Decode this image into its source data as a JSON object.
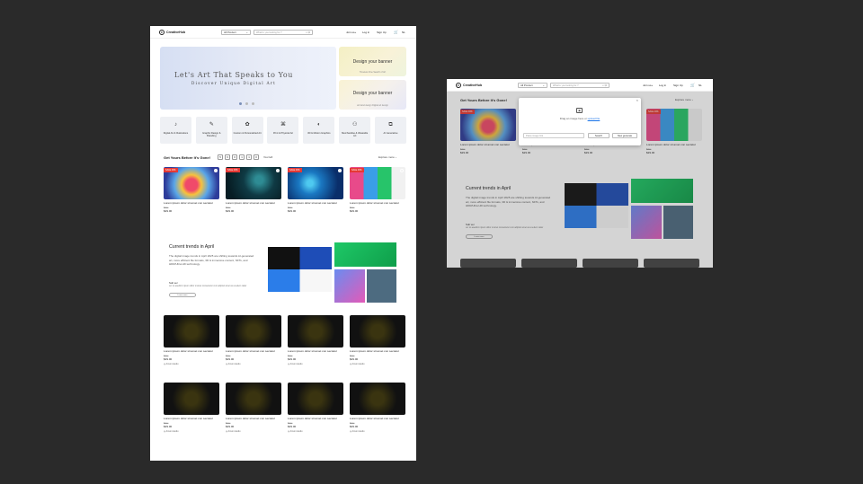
{
  "brand": {
    "name": "CreativeHub"
  },
  "header": {
    "category_select": "All Product",
    "search_placeholder": "What're you looking for ?",
    "join": "Join us+",
    "login": "Log in",
    "signup": "Sign Up",
    "lang": "NL"
  },
  "hero": {
    "title": "Let's Art That Speaks to You",
    "subtitle": "Discover Unique Digital Art",
    "side_banners": [
      {
        "title": "Design your banner",
        "caption": "Timeless Fine Search of Art"
      },
      {
        "title": "Design your banner",
        "caption": "ai brand design Digital art design"
      }
    ]
  },
  "categories": [
    {
      "label": "Digital Art & Illustrations",
      "icon": "brush-icon"
    },
    {
      "label": "Graphic Design & Branding",
      "icon": "pen-nib-icon"
    },
    {
      "label": "Custom & Personalized Art",
      "icon": "palette-icon"
    },
    {
      "label": "Print & Physical Art",
      "icon": "frame-icon"
    },
    {
      "label": "3D & Motion Graphics",
      "icon": "cube-icon"
    },
    {
      "label": "Merchandise & Wearable Art",
      "icon": "shirt-icon"
    },
    {
      "label": "AI Generative",
      "icon": "sparkle-icon"
    }
  ],
  "deals": {
    "heading": "Get Yours Before It's Gone!",
    "timer": [
      "5",
      "6",
      "0",
      "1",
      "1",
      "0"
    ],
    "timer_label": "Your left",
    "explore": "Explore more",
    "badge": "SALE 40%",
    "products": [
      {
        "title": "Lorem ipsum dolor sit amet con sectetur",
        "old_price": "$2oo",
        "price": "$29.00"
      },
      {
        "title": "Lorem ipsum dolor sit amet con sectetur",
        "old_price": "$2oo",
        "price": "$29.00"
      },
      {
        "title": "Lorem ipsum dolor sit amet con sectetur",
        "old_price": "$2oo",
        "price": "$29.00"
      },
      {
        "title": "Lorem ipsum dolor sit amet con sectetur",
        "old_price": "$2oo",
        "price": "$29.00"
      }
    ]
  },
  "trends": {
    "heading": "Current trends in April",
    "body": "The digital image trends in April 2025 are shifting towards AI-generated art, more efficient file formats, 3D & immersive content, NFTs, and HDR/Ultra HD technology.",
    "sub_heading": "Sub ver",
    "sub_body": "ver so eaedinm ipsum dolor si amet consectetur cum adipisci amet as a sedem rader",
    "button": "Learn more"
  },
  "gallery": {
    "artist": "Amoni studio",
    "products": [
      {
        "title": "Lorem ipsum dolor sit amet con sectetur",
        "old_price": "$2oo",
        "price": "$29.00"
      },
      {
        "title": "Lorem ipsum dolor sit amet con sectetur",
        "old_price": "$2oo",
        "price": "$29.00"
      },
      {
        "title": "Lorem ipsum dolor sit amet con sectetur",
        "old_price": "$2oo",
        "price": "$29.00"
      },
      {
        "title": "Lorem ipsum dolor sit amet con sectetur",
        "old_price": "$2oo",
        "price": "$29.00"
      },
      {
        "title": "Lorem ipsum dolor sit amet con sectetur",
        "old_price": "$2oo",
        "price": "$29.00"
      },
      {
        "title": "Lorem ipsum dolor sit amet con sectetur",
        "old_price": "$2oo",
        "price": "$29.00"
      },
      {
        "title": "Lorem ipsum dolor sit amet con sectetur",
        "old_price": "$2oo",
        "price": "$29.00"
      },
      {
        "title": "Lorem ipsum dolor sit amet con sectetur",
        "old_price": "$2oo",
        "price": "$29.00"
      }
    ]
  },
  "modal": {
    "drop_text": "Drag an image here or",
    "upload_link": "upload file",
    "link_placeholder": "Paste image link",
    "search_button": "Search",
    "generate_button": "New generate",
    "close": "×"
  },
  "colors": {
    "accent": "#1a73e8",
    "sale": "#e53935",
    "canvas": "#2a2a2a"
  }
}
